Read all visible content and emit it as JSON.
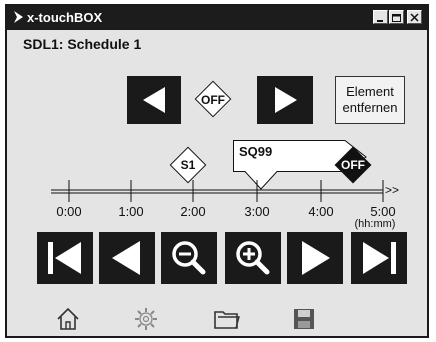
{
  "window": {
    "title": "x-touchBOX"
  },
  "schedule": {
    "heading": "SDL1: Schedule 1",
    "current_state": "OFF",
    "remove_button_label": "Element\nentfernen"
  },
  "timeline": {
    "ticks": [
      "0:00",
      "1:00",
      "2:00",
      "3:00",
      "4:00",
      "5:00"
    ],
    "unit": "(hh:mm)",
    "arrow": ">>",
    "markers": [
      {
        "label": "S1",
        "time": "2:00"
      },
      {
        "label": "SQ99",
        "time": "3:00"
      },
      {
        "label": "OFF",
        "time": "4:20"
      }
    ]
  },
  "icons": {
    "title": "xtouch-logo-icon",
    "prev": "triangle-left-icon",
    "next": "triangle-right-icon",
    "first": "skip-to-start-icon",
    "back": "step-back-icon",
    "zoom_out": "zoom-out-icon",
    "zoom_in": "zoom-in-icon",
    "forward": "step-forward-icon",
    "last": "skip-to-end-icon",
    "home": "home-icon",
    "settings": "gear-icon",
    "folder": "folder-icon",
    "save": "save-disk-icon"
  }
}
